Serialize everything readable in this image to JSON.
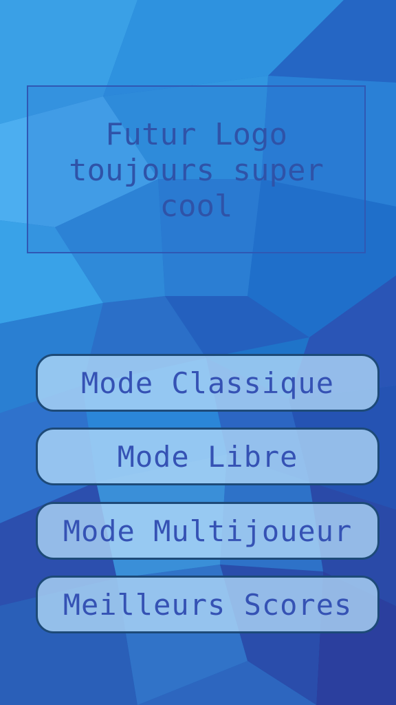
{
  "logo": {
    "text": "Futur Logo toujours super cool"
  },
  "menu": {
    "classic_label": "Mode Classique",
    "free_label": "Mode Libre",
    "multiplayer_label": "Mode Multijoueur",
    "scores_label": "Meilleurs Scores"
  },
  "colors": {
    "background": "#1f74c9",
    "button_fill": "#b2daf8",
    "button_border": "#1d4a78",
    "button_text": "#3552b4",
    "logo_border": "#2f58b4",
    "logo_text": "#2f53a8"
  }
}
